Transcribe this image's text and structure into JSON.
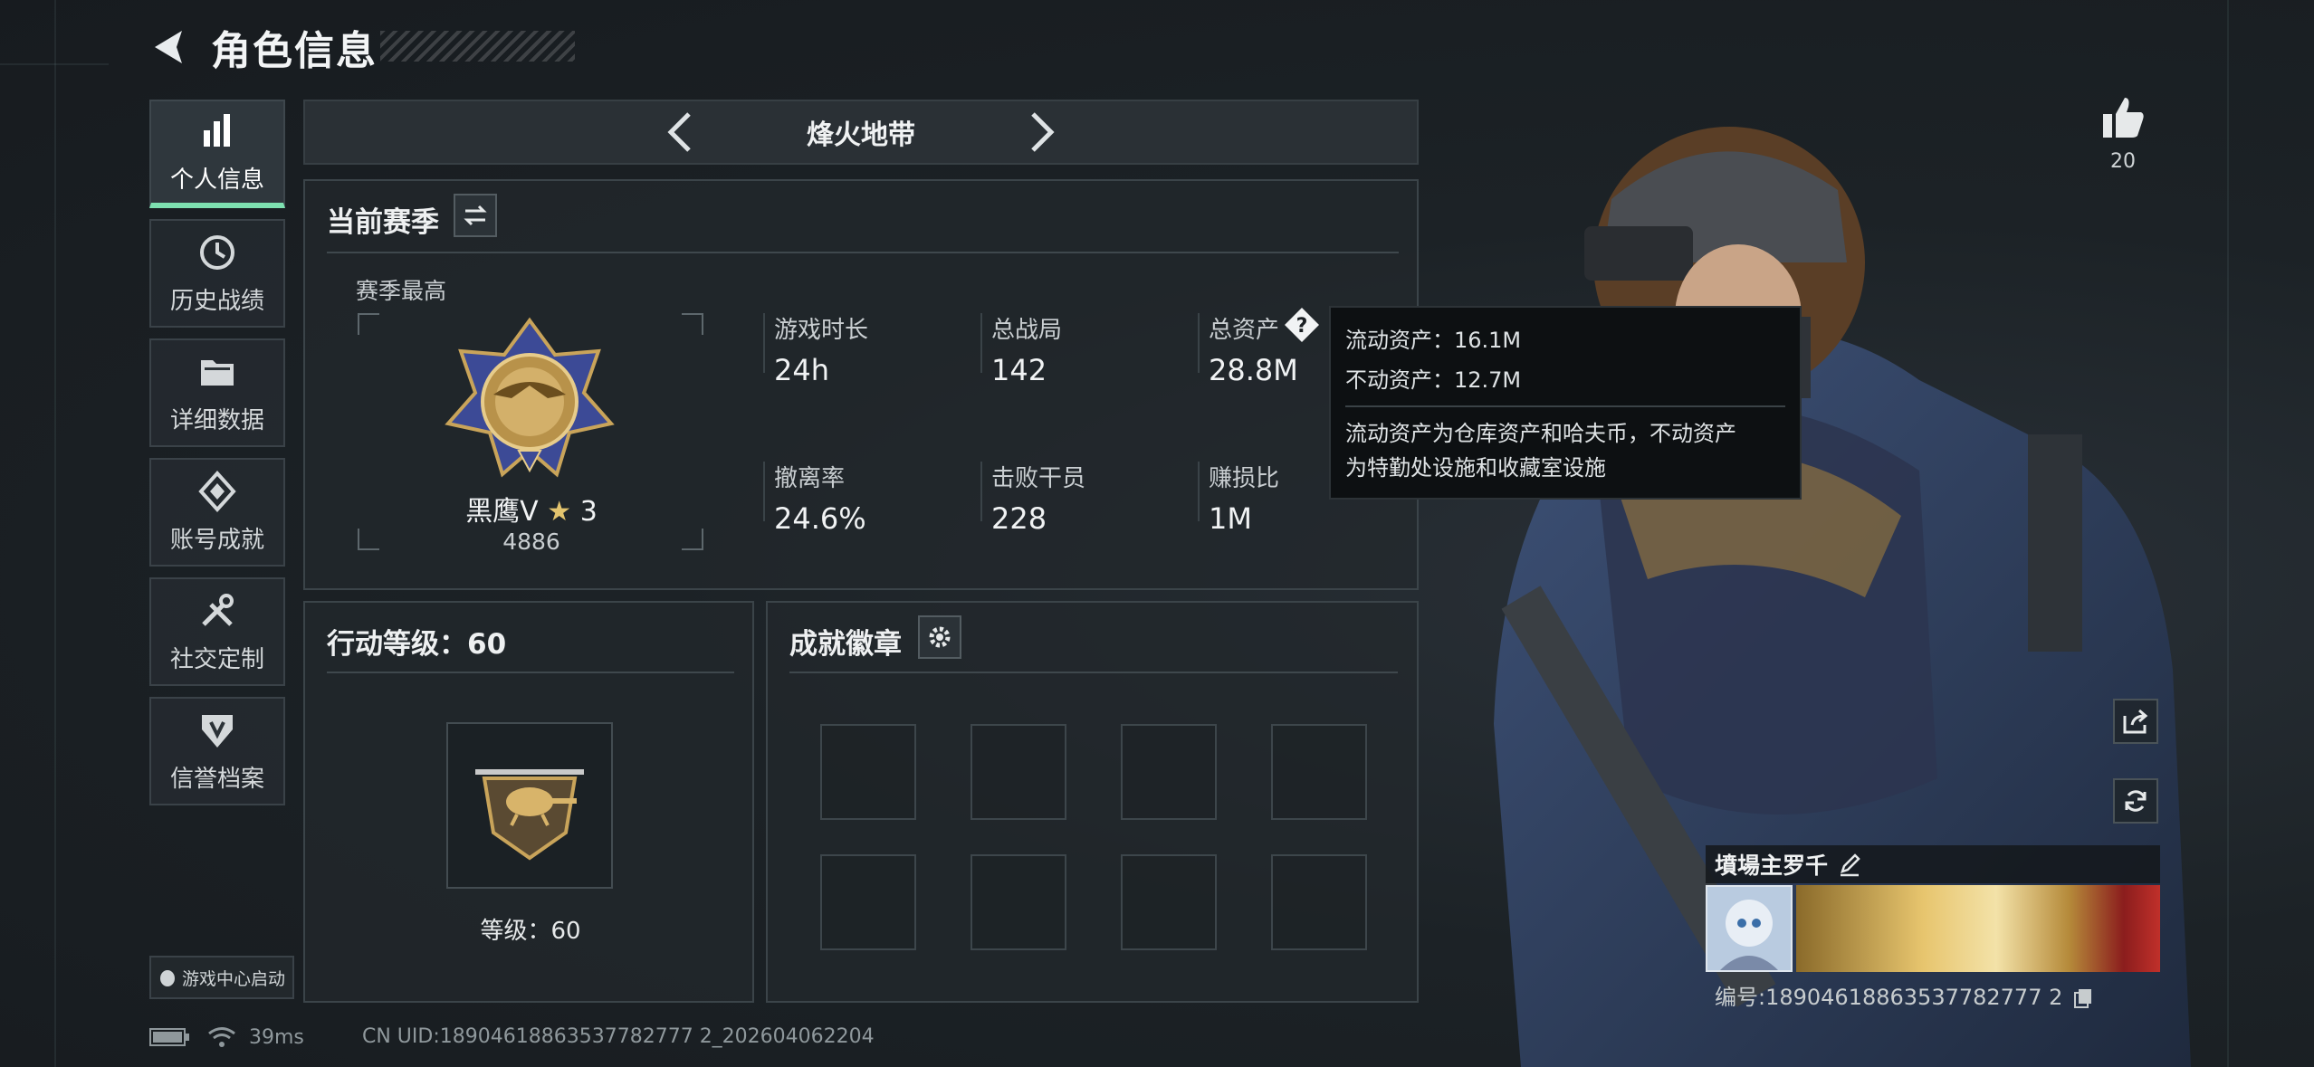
{
  "header": {
    "title": "角色信息"
  },
  "sidebar": {
    "items": [
      {
        "label": "个人信息",
        "active": true,
        "icon": "bar-chart-icon"
      },
      {
        "label": "历史战绩",
        "active": false,
        "icon": "clock-icon"
      },
      {
        "label": "详细数据",
        "active": false,
        "icon": "folder-icon"
      },
      {
        "label": "账号成就",
        "active": false,
        "icon": "achievement-icon"
      },
      {
        "label": "社交定制",
        "active": false,
        "icon": "tools-icon"
      },
      {
        "label": "信誉档案",
        "active": false,
        "icon": "shield-icon"
      }
    ],
    "launch_label": "游戏中心启动"
  },
  "mode": {
    "name": "烽火地带"
  },
  "season": {
    "title": "当前赛季",
    "best_label": "赛季最高",
    "rank_name": "黑鹰V",
    "rank_star": "★",
    "rank_stars": "3",
    "rank_score": "4886",
    "stats": [
      {
        "label": "游戏时长",
        "value": "24h"
      },
      {
        "label": "总战局",
        "value": "142"
      },
      {
        "label": "总资产",
        "value": "28.8M"
      },
      {
        "label": "撤离率",
        "value": "24.6%"
      },
      {
        "label": "击败干员",
        "value": "228"
      },
      {
        "label": "赚损比",
        "value": "1M"
      }
    ]
  },
  "tooltip": {
    "liquid": "流动资产：16.1M",
    "fixed": "不动资产：12.7M",
    "desc1": "流动资产为仓库资产和哈夫币，不动资产",
    "desc2": "为特勤处设施和收藏室设施"
  },
  "level": {
    "title": "行动等级：60",
    "label": "等级：60"
  },
  "badges": {
    "title": "成就徽章",
    "slots": 8
  },
  "profile": {
    "likes": "20",
    "name": "墳場主罗千",
    "id": "编号:18904618863537782777 2"
  },
  "footer": {
    "ping": "39ms",
    "uid": "CN UID:18904618863537782777 2_202604062204"
  },
  "colors": {
    "accent": "#7de0b0",
    "background": "#1a1f23",
    "tooltip_bg": "#0d1012"
  }
}
